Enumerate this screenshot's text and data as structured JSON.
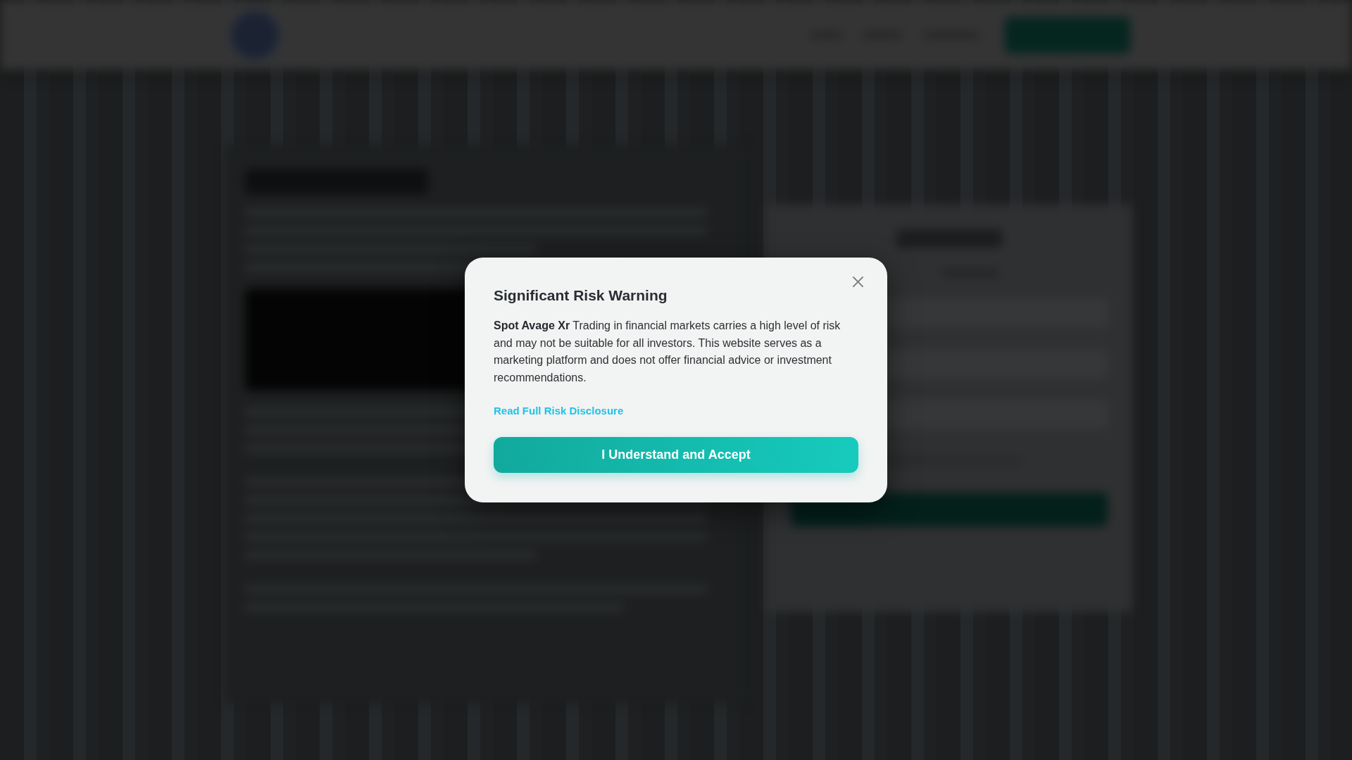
{
  "risk_modal": {
    "title": "Significant Risk Warning",
    "message": "**Spot Avage Xr** Trading in financial markets carries a high level of risk and may not be suitable for all investors. This website serves as a marketing platform and does not offer financial advice or investment recommendations.",
    "link": "Read Full Risk Disclosure",
    "accept_button": "I Understand and Accept"
  }
}
